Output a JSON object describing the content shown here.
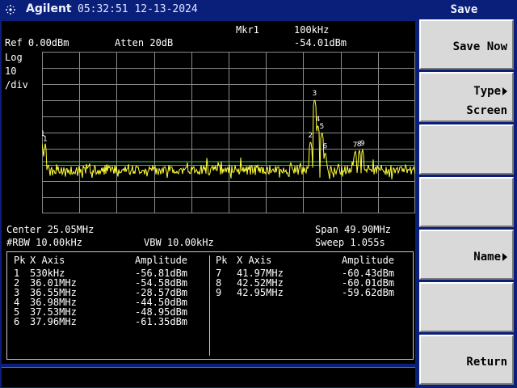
{
  "header": {
    "brand": "Agilent",
    "datetime": "05:32:51 12-13-2024"
  },
  "display": {
    "marker_label": "Mkr1",
    "marker_freq": "100kHz",
    "marker_amp": "-54.01dBm",
    "ref_level": "Ref 0.00dBm",
    "atten": "Atten 20dB",
    "scale_type": "Log",
    "scale_value": "10",
    "scale_unit": "/div",
    "center": "Center 25.05MHz",
    "span": "Span 49.90MHz",
    "rbw": "#RBW 10.00kHz",
    "vbw": "VBW 10.00kHz",
    "sweep": "Sweep 1.055s"
  },
  "trace": {
    "color": "#ffff3c",
    "display_line_color": "#30d040",
    "grid_color": "#8a8a8a"
  },
  "peak_table": {
    "headers": {
      "pk": "Pk",
      "x_axis": "X Axis",
      "amplitude": "Amplitude"
    },
    "left": [
      {
        "pk": "1",
        "x": "530kHz",
        "amp": "-56.81dBm"
      },
      {
        "pk": "2",
        "x": "36.01MHz",
        "amp": "-54.58dBm"
      },
      {
        "pk": "3",
        "x": "36.55MHz",
        "amp": "-28.57dBm"
      },
      {
        "pk": "4",
        "x": "36.98MHz",
        "amp": "-44.50dBm"
      },
      {
        "pk": "5",
        "x": "37.53MHz",
        "amp": "-48.95dBm"
      },
      {
        "pk": "6",
        "x": "37.96MHz",
        "amp": "-61.35dBm"
      }
    ],
    "right": [
      {
        "pk": "7",
        "x": "41.97MHz",
        "amp": "-60.43dBm"
      },
      {
        "pk": "8",
        "x": "42.52MHz",
        "amp": "-60.01dBm"
      },
      {
        "pk": "9",
        "x": "42.95MHz",
        "amp": "-59.62dBm"
      }
    ]
  },
  "menu": {
    "title": "Save",
    "keys": [
      {
        "line1": "Save Now",
        "line2": ""
      },
      {
        "line1": "Type",
        "line2": "Screen"
      },
      {
        "line1": "",
        "line2": ""
      },
      {
        "line1": "",
        "line2": ""
      },
      {
        "line1": "Name",
        "line2": ""
      },
      {
        "line1": "",
        "line2": ""
      },
      {
        "line1": "Return",
        "line2": ""
      }
    ]
  }
}
